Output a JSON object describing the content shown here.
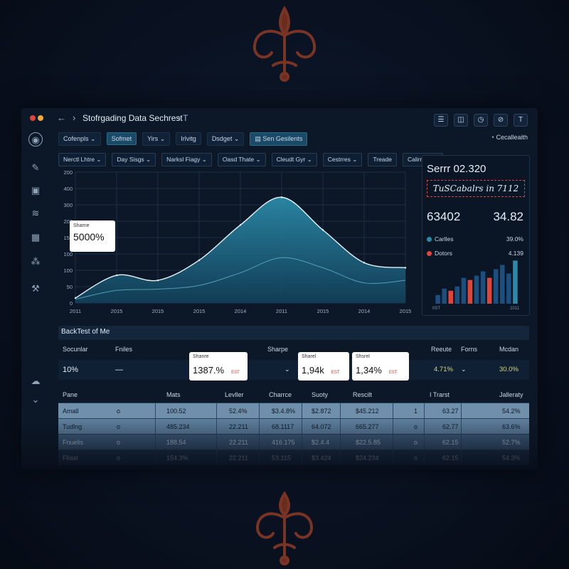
{
  "window": {
    "title": "Stofrgading Data Sechrest",
    "title_suffix": "› T",
    "dot_colors": [
      "#e0453a",
      "#f0a93a"
    ]
  },
  "titlebar_icons": [
    "menu-icon",
    "cup-icon",
    "clock-icon",
    "ban-icon",
    "text-icon"
  ],
  "sidebar_icons": [
    "compass-icon",
    "edit-icon",
    "box-icon",
    "layers-icon",
    "grid-icon",
    "nodes-icon",
    "wrench-icon",
    "cloud-icon",
    "chevron-down-icon"
  ],
  "toolbar": {
    "items": [
      "Cofenpls ⌄",
      "Sofmet",
      "Yirs ⌄",
      "Irlvitg",
      "Dsdget ⌄"
    ],
    "action": "Sen Gesilents",
    "right": "Cecalleaith"
  },
  "filters": [
    "Nerctl Lhtre ⌄",
    "Day Sisgs ⌄",
    "Narksl Fiagy ⌄",
    "Oasd Thate ⌄",
    "Cleudt Gyr ⌄",
    "Cestrres ⌄",
    "Treade",
    "Calirrues ⌄"
  ],
  "chart": {
    "accent": "#2b8aa8",
    "y_ticks": [
      "0",
      "50",
      "100",
      "100",
      "150",
      "200",
      "300",
      "400",
      "200"
    ],
    "x_ticks": [
      "2011",
      "2015",
      "2015",
      "2015",
      "2014",
      "2011",
      "2015",
      "2014",
      "2015"
    ]
  },
  "chart_data": {
    "type": "area",
    "x": [
      "2011",
      "2015",
      "2015",
      "2015",
      "2014",
      "2011",
      "2015",
      "2014",
      "2015"
    ],
    "series": [
      {
        "values": [
          20,
          110,
          90,
          170,
          310,
          420,
          290,
          160,
          140
        ]
      },
      {
        "values": [
          15,
          50,
          55,
          70,
          120,
          180,
          140,
          80,
          90
        ]
      }
    ],
    "ylim": [
      0,
      520
    ],
    "grid": true
  },
  "tooltip": {
    "label": "Sharne",
    "value": "5000%"
  },
  "panel": {
    "title": "Serrr 02.320",
    "hand_note": "TuSCabalrs in 7112",
    "big_left": "63402",
    "big_right": "34.82",
    "legend": [
      {
        "label": "Carlles",
        "value": "39.0%",
        "color": "#2b8aa8"
      },
      {
        "label": "Dotors",
        "value": "4.139",
        "color": "#e0453a"
      }
    ],
    "bar_colors": {
      "blue": "#1c4e7e",
      "red": "#e0453a",
      "teal": "#2b8aa8"
    },
    "bar_values": [
      20,
      35,
      30,
      40,
      60,
      55,
      65,
      75,
      60,
      80,
      90,
      70,
      100
    ],
    "bar_red_index": [
      2,
      5,
      8
    ],
    "x_left": "0ST",
    "x_right": "1011"
  },
  "section": {
    "title": "BackTest of Me",
    "labels": [
      "Socunlar",
      "Fniles",
      "Sharpe",
      "Reeute",
      "Forns",
      "Mcdan"
    ],
    "values": {
      "first": "10%",
      "dash": "—",
      "chevron": "⌄",
      "yellow": "4.71%",
      "dash2": "⌄",
      "last": "30.0%"
    },
    "cards": [
      {
        "label": "Shanre",
        "value": "1387.%",
        "tag": "EST"
      },
      {
        "label": "Sharel",
        "value": "1,94k",
        "tag": "EST"
      },
      {
        "label": "Shsrel",
        "value": "1,34%",
        "tag": "EST"
      }
    ]
  },
  "table": {
    "headers": [
      "Pane",
      "Mats",
      "Levller",
      "Charrce",
      "Suoty",
      "Rescilt",
      "I Trarst",
      "Jalleraty"
    ],
    "rows": [
      [
        "Amall",
        "o",
        "100.52",
        "52.4%",
        "$3.4.8%",
        "$2.872",
        "$45.212",
        "1",
        "63.27",
        "54.2%"
      ],
      [
        "Tudlng",
        "o",
        "485.234",
        "22.211",
        "68.1117",
        "64.072",
        "665.277",
        "o",
        "62.77",
        "63.6%"
      ],
      [
        "Fnuelis",
        "o",
        "188.54",
        "22.211",
        "416.175",
        "$2.4.4",
        "$22.5.85",
        "o",
        "62.15",
        "52.7%"
      ],
      [
        "Fliaal",
        "o",
        "154.3%",
        "22.211",
        "53.115",
        "$3.424",
        "$24.234",
        "o",
        "62.15",
        "54.3%"
      ]
    ]
  }
}
